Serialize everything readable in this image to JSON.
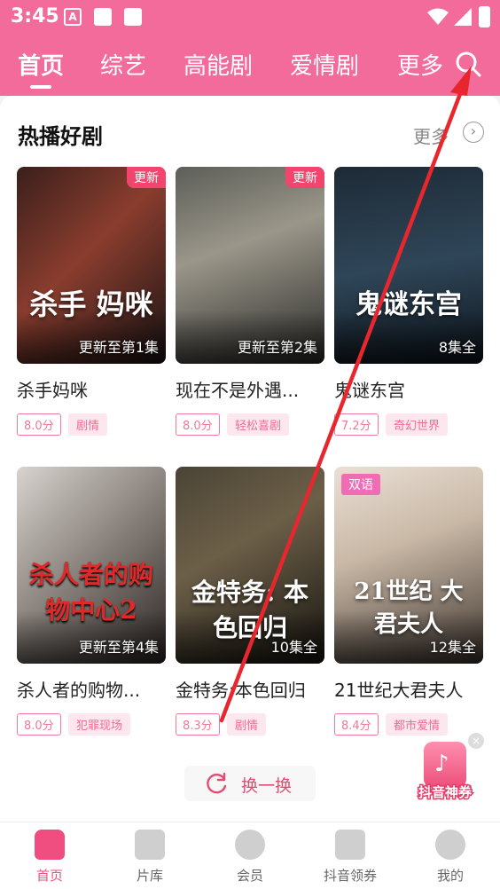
{
  "status": {
    "time": "3:45",
    "icon_a": "A"
  },
  "tabs": [
    {
      "label": "首页",
      "active": true
    },
    {
      "label": "综艺"
    },
    {
      "label": "高能剧"
    },
    {
      "label": "爱情剧"
    },
    {
      "label": "更多"
    }
  ],
  "section": {
    "title": "热播好剧",
    "more": "更多"
  },
  "dramas": [
    {
      "title": "杀手妈咪",
      "poster_text": "杀手 妈咪",
      "episode": "更新至第1集",
      "badge": "更新",
      "score": "8.0分",
      "genre": "剧情"
    },
    {
      "title": "现在不是外遇...",
      "poster_text": "",
      "episode": "更新至第2集",
      "badge": "更新",
      "score": "8.0分",
      "genre": "轻松喜剧"
    },
    {
      "title": "鬼谜东宫",
      "poster_text": "鬼谜东宫",
      "episode": "8集全",
      "badge": "",
      "score": "7.2分",
      "genre": "奇幻世界"
    },
    {
      "title": "杀人者的购物...",
      "poster_text": "杀人者的购物中心2",
      "episode": "更新至第4集",
      "badge": "",
      "score": "8.0分",
      "genre": "犯罪现场"
    },
    {
      "title": "金特务:本色回归",
      "poster_text": "金特务: 本色回归",
      "episode": "10集全",
      "badge": "",
      "score": "8.3分",
      "genre": "剧情"
    },
    {
      "title": "21世纪大君夫人",
      "poster_text": "21世纪 大君夫人",
      "episode": "12集全",
      "badge": "双语",
      "score": "8.4分",
      "genre": "都市爱情"
    }
  ],
  "refresh_label": "换一换",
  "coupon": {
    "label": "抖音神券",
    "close": "×"
  },
  "nav": [
    {
      "label": "首页",
      "icon": "home-icon",
      "active": true
    },
    {
      "label": "片库",
      "icon": "video-library-icon"
    },
    {
      "label": "会员",
      "icon": "vip-icon"
    },
    {
      "label": "抖音领券",
      "icon": "tiktok-coupon-icon"
    },
    {
      "label": "我的",
      "icon": "profile-icon"
    }
  ],
  "colors": {
    "brand": "#f26b9a",
    "accent": "#f04e80",
    "annotation_arrow": "#e8262e"
  }
}
